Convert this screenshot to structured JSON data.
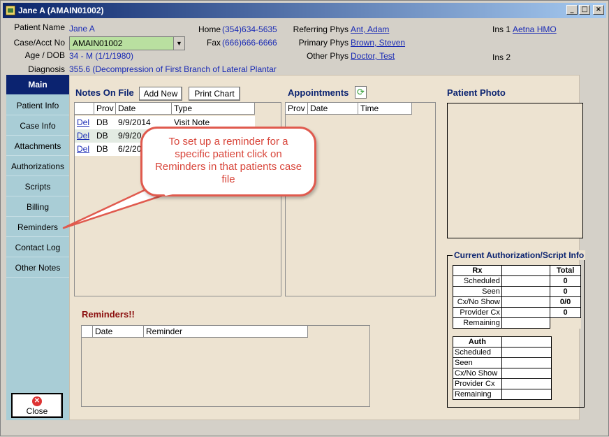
{
  "window": {
    "title": "Jane A (AMAIN01002)"
  },
  "header": {
    "patient_name_label": "Patient Name",
    "patient_name": "Jane A",
    "case_acct_label": "Case/Acct No",
    "case_acct_value": "AMAIN01002",
    "age_dob_label": "Age / DOB",
    "age_dob": "34 - M (1/1/1980)",
    "diagnosis_label": "Diagnosis",
    "diagnosis": "355.6 (Decompression of First Branch of Lateral Plantar",
    "home_label": "Home",
    "home": "(354)634-5635",
    "fax_label": "Fax",
    "fax": "(666)666-6666",
    "referring_label": "Referring Phys",
    "referring": "Ant, Adam",
    "primary_label": "Primary Phys",
    "primary": "Brown, Steven",
    "other_label": "Other Phys",
    "other": "Doctor, Test",
    "ins1_label": "Ins 1",
    "ins1": "Aetna HMO",
    "ins2_label": "Ins 2"
  },
  "sidebar": {
    "items": [
      {
        "label": "Main"
      },
      {
        "label": "Patient Info"
      },
      {
        "label": "Case Info"
      },
      {
        "label": "Attachments"
      },
      {
        "label": "Authorizations"
      },
      {
        "label": "Scripts"
      },
      {
        "label": "Billing"
      },
      {
        "label": "Reminders"
      },
      {
        "label": "Contact Log"
      },
      {
        "label": "Other Notes"
      }
    ],
    "close_label": "Close"
  },
  "notes": {
    "title": "Notes On File",
    "add_new": "Add New",
    "print_chart": "Print Chart",
    "columns": [
      "Prov",
      "Date",
      "Type"
    ],
    "rows": [
      {
        "action": "Del",
        "prov": "DB",
        "date": "9/9/2014",
        "type": "Visit Note"
      },
      {
        "action": "Del",
        "prov": "DB",
        "date": "9/9/20",
        "type": ""
      },
      {
        "action": "Del",
        "prov": "DB",
        "date": "6/2/20",
        "type": ""
      }
    ]
  },
  "appointments": {
    "title": "Appointments",
    "columns": [
      "Prov",
      "Date",
      "Time"
    ]
  },
  "photo": {
    "title": "Patient Photo"
  },
  "auth_info": {
    "title": "Current Authorization/Script Info",
    "rx": {
      "header": "Rx",
      "total_header": "Total",
      "rows": [
        {
          "label": "Scheduled",
          "total": "0"
        },
        {
          "label": "Seen",
          "total": "0"
        },
        {
          "label": "Cx/No Show",
          "total": "0/0"
        },
        {
          "label": "Provider Cx",
          "total": "0"
        },
        {
          "label": "Remaining",
          "total": ""
        }
      ]
    },
    "auth": {
      "header": "Auth",
      "rows": [
        "Scheduled",
        "Seen",
        "Cx/No Show",
        "Provider Cx",
        "Remaining"
      ]
    }
  },
  "reminders": {
    "title": "Reminders!!",
    "columns": [
      "Date",
      "Reminder"
    ]
  },
  "callout": {
    "text": "To set up a reminder for a specific patient click on Reminders in that patients case file"
  },
  "colors": {
    "sidebar_active": "#0b2370",
    "sidebar_bg": "#a9cdd6",
    "link": "#1a2bb5",
    "callout": "#e05a4e"
  }
}
